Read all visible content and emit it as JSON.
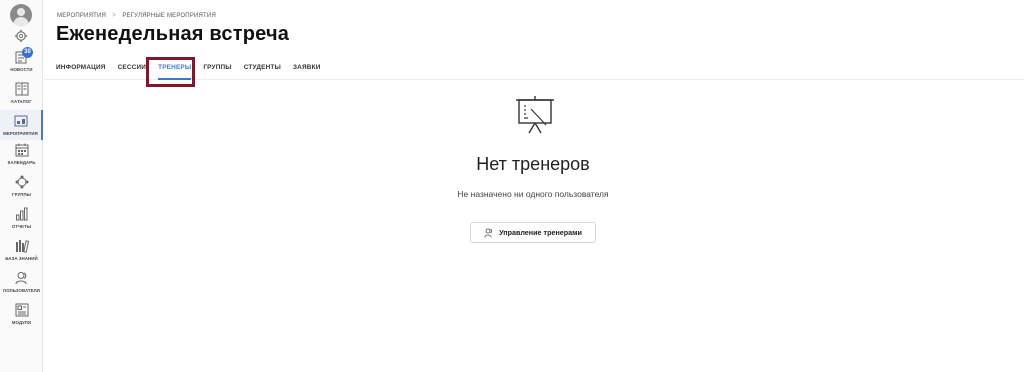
{
  "header": {
    "breadcrumb": [
      "МЕРОПРИЯТИЯ",
      "РЕГУЛЯРНЫЕ МЕРОПРИЯТИЯ"
    ],
    "breadcrumb_sep": ">",
    "title": "Еженедельная встреча"
  },
  "tabs": [
    {
      "label": "ИНФОРМАЦИЯ",
      "active": false
    },
    {
      "label": "СЕССИИ",
      "active": false
    },
    {
      "label": "ТРЕНЕРЫ",
      "active": true
    },
    {
      "label": "ГРУППЫ",
      "active": false
    },
    {
      "label": "СТУДЕНТЫ",
      "active": false
    },
    {
      "label": "ЗАЯВКИ",
      "active": false
    }
  ],
  "sidebar": {
    "news_badge": "30",
    "items": [
      {
        "label": "НОВОСТИ",
        "icon": "news-icon",
        "active": false
      },
      {
        "label": "КАТАЛОГ",
        "icon": "catalog-icon",
        "active": false
      },
      {
        "label": "МЕРОПРИЯТИЯ",
        "icon": "events-icon",
        "active": true
      },
      {
        "label": "КАЛЕНДАРЬ",
        "icon": "calendar-icon",
        "active": false
      },
      {
        "label": "ГРУППЫ",
        "icon": "groups-icon",
        "active": false
      },
      {
        "label": "ОТЧЕТЫ",
        "icon": "reports-icon",
        "active": false
      },
      {
        "label": "БАЗА ЗНАНИЙ",
        "icon": "knowledge-base-icon",
        "active": false
      },
      {
        "label": "ПОЛЬЗОВАТЕЛИ",
        "icon": "users-icon",
        "active": false
      },
      {
        "label": "МОДУЛИ",
        "icon": "modules-icon",
        "active": false
      }
    ]
  },
  "empty_state": {
    "title": "Нет тренеров",
    "subtitle": "Не назначено ни одного пользователя",
    "button_label": "Управление тренерами",
    "icon": "presentation-board-icon"
  },
  "colors": {
    "accent": "#3d79c7",
    "highlight": "#7a1a2a",
    "badge": "#3b6fd4"
  }
}
